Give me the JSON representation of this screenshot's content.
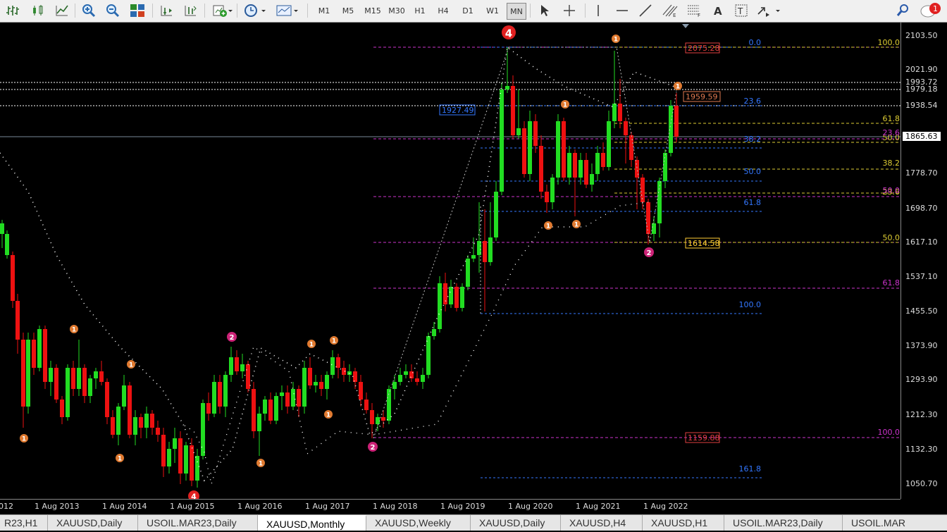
{
  "toolbar": {
    "timeframes": [
      "M1",
      "M5",
      "M15",
      "M30",
      "H1",
      "H4",
      "D1",
      "W1",
      "MN"
    ],
    "active_timeframe": "MN",
    "alert_count": "1"
  },
  "chart": {
    "symbol_label": "XAUUSD,Monthly",
    "wave_label_4": "4",
    "price_boxes": {
      "label_2075": "2075.28",
      "label_1959": "1959.59",
      "label_1927": "1927.49",
      "label_1614": "1614.58",
      "label_1159": "1159.88"
    },
    "fib_blue_labels": [
      "0.0",
      "23.6",
      "38.2",
      "50.0",
      "61.8",
      "100.0",
      "161.8"
    ],
    "fib_yellow_labels": [
      "100.0",
      "61.8",
      "50.0",
      "38.2",
      "23.6",
      "50.0"
    ],
    "fib_magenta_labels": [
      "23.6",
      "50.0",
      "61.8",
      "100.0"
    ],
    "wave_1_label": "1",
    "wave_2_label": "2",
    "wave_4_label": "4"
  },
  "price_axis": {
    "labels": [
      "2103.50",
      "2021.90",
      "1993.72",
      "1979.18",
      "1938.54",
      "1865.63",
      "1778.70",
      "1698.70",
      "1617.10",
      "1537.10",
      "1455.50",
      "1373.90",
      "1293.90",
      "1212.30",
      "1132.30",
      "1050.70"
    ],
    "current_price": "1865.63"
  },
  "time_axis": {
    "labels": [
      "012",
      "1 Aug 2013",
      "1 Aug 2014",
      "1 Aug 2015",
      "1 Aug 2016",
      "1 Aug 2017",
      "1 Aug 2018",
      "1 Aug 2019",
      "1 Aug 2020",
      "1 Aug 2021",
      "1 Aug 2022"
    ]
  },
  "tabs": [
    {
      "label": "R23,H1"
    },
    {
      "label": "XAUUSD,Daily"
    },
    {
      "label": "USOIL.MAR23,Daily"
    },
    {
      "label": "XAUUSD,Monthly"
    },
    {
      "label": "XAUUSD,Weekly"
    },
    {
      "label": "XAUUSD,Daily"
    },
    {
      "label": "XAUUSD,H4"
    },
    {
      "label": "XAUUSD,H1"
    },
    {
      "label": "USOIL.MAR23,Daily"
    },
    {
      "label": "USOIL.MAR"
    }
  ],
  "active_tab": "XAUUSD,Monthly",
  "colors": {
    "bull": "#22dd22",
    "bear": "#ee1111",
    "fib_magenta": "#cc33cc",
    "fib_blue": "#3377ff",
    "fib_yellow": "#ddcc33",
    "wave_orange": "#e07a30",
    "wave_pink": "#cc2277"
  }
}
